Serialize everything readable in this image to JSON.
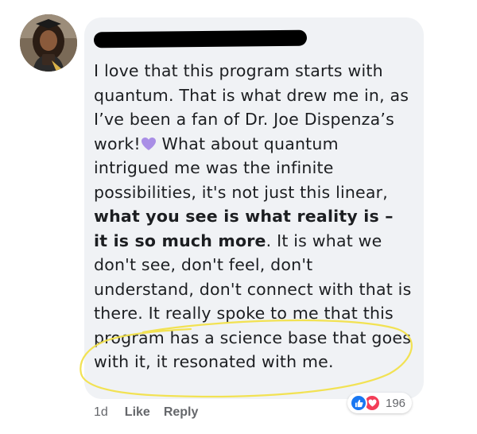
{
  "comment": {
    "author_redacted": true,
    "text_part1": "I love that this program starts with quantum. That is what drew me in, as I’ve been a fan of Dr. Joe Dispenza’s work!",
    "emoji": "purple-heart",
    "text_part2": " What about quantum intrigued me was the infinite possibilities, it's not just this linear, ",
    "text_bold": "what you see is what reality is – it is so much more",
    "text_part3": ". It is what we don't see, don't feel, don't understand, don't connect with that is there. It really spoke to me that this program has a science base that goes with it, it resonated with me."
  },
  "meta": {
    "time": "1d",
    "like_label": "Like",
    "reply_label": "Reply"
  },
  "reactions": {
    "types": [
      "like",
      "love"
    ],
    "count": "196"
  },
  "colors": {
    "bubble": "#f0f2f5",
    "text": "#1c1e21",
    "meta": "#65676b",
    "like_blue": "#1877f2",
    "love_red": "#f33e58",
    "heart_purple": "#a98ee6",
    "highlight_yellow": "#f1e04a"
  }
}
